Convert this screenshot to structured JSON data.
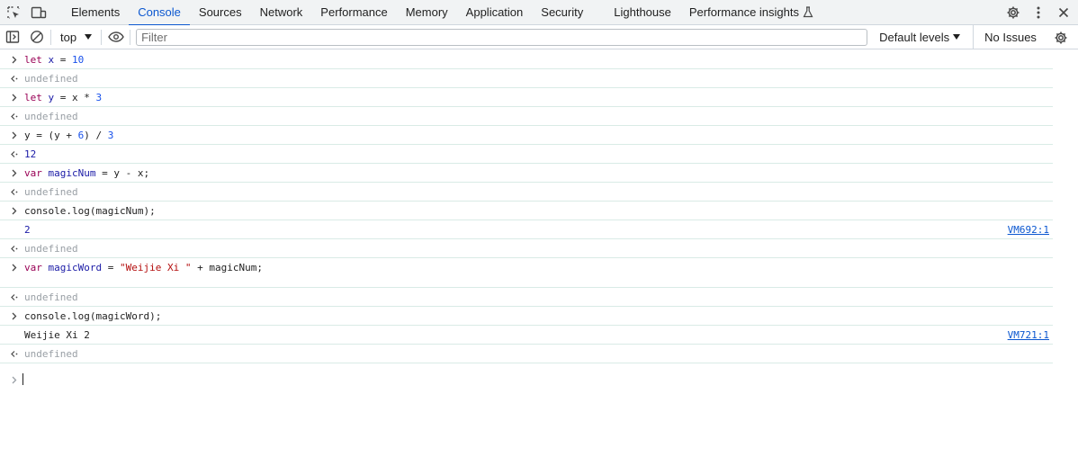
{
  "tabs": [
    "Elements",
    "Console",
    "Sources",
    "Network",
    "Performance",
    "Memory",
    "Application",
    "Security",
    "Lighthouse",
    "Performance insights"
  ],
  "active_tab": "Console",
  "toolbar": {
    "context": "top",
    "filter_placeholder": "Filter",
    "filter_value": "",
    "levels": "Default levels",
    "issues": "No Issues"
  },
  "console": {
    "lines": [
      {
        "kind": "input",
        "tokens": [
          [
            "kw",
            "let"
          ],
          [
            "plain",
            " "
          ],
          [
            "vname",
            "x"
          ],
          [
            "plain",
            " = "
          ],
          [
            "num",
            "10"
          ]
        ]
      },
      {
        "kind": "result",
        "text": "undefined",
        "muted": true
      },
      {
        "kind": "input",
        "tokens": [
          [
            "kw",
            "let"
          ],
          [
            "plain",
            " "
          ],
          [
            "vname",
            "y"
          ],
          [
            "plain",
            " = x * "
          ],
          [
            "num",
            "3"
          ]
        ]
      },
      {
        "kind": "result",
        "text": "undefined",
        "muted": true
      },
      {
        "kind": "input",
        "tokens": [
          [
            "plain",
            "y = (y + "
          ],
          [
            "num",
            "6"
          ],
          [
            "plain",
            ") / "
          ],
          [
            "num",
            "3"
          ]
        ]
      },
      {
        "kind": "result",
        "text": "12",
        "muted": false
      },
      {
        "kind": "input",
        "tokens": [
          [
            "kw",
            "var"
          ],
          [
            "plain",
            " "
          ],
          [
            "vname",
            "magicNum"
          ],
          [
            "plain",
            " = y - x;"
          ]
        ]
      },
      {
        "kind": "result",
        "text": "undefined",
        "muted": true
      },
      {
        "kind": "input",
        "tokens": [
          [
            "plain",
            "console.log(magicNum);"
          ]
        ]
      },
      {
        "kind": "log",
        "text": "2",
        "source": "VM692:1",
        "color": "#1a1aa6"
      },
      {
        "kind": "result",
        "text": "undefined",
        "muted": true
      },
      {
        "kind": "input-tall",
        "tokens": [
          [
            "kw",
            "var"
          ],
          [
            "plain",
            " "
          ],
          [
            "vname",
            "magicWord"
          ],
          [
            "plain",
            " = "
          ],
          [
            "str",
            "\"Weijie Xi \""
          ],
          [
            "plain",
            " + magicNum;"
          ]
        ]
      },
      {
        "kind": "result",
        "text": "undefined",
        "muted": true
      },
      {
        "kind": "input",
        "tokens": [
          [
            "plain",
            "console.log(magicWord);"
          ]
        ]
      },
      {
        "kind": "log",
        "text": "Weijie Xi 2",
        "source": "VM721:1",
        "color": "#1f1f1f"
      },
      {
        "kind": "result",
        "text": "undefined",
        "muted": true
      }
    ]
  },
  "colors": {
    "accent": "#0b57d0",
    "keyword": "#990055",
    "variable": "#1a1aa6",
    "number": "#1750eb",
    "string": "#b40e0e",
    "muted": "#9aa0a6"
  },
  "icons": {
    "inspect": "inspect-element-icon",
    "device": "device-toolbar-icon",
    "flask": "flask-icon",
    "settings": "gear-icon",
    "more": "more-vertical-icon",
    "close": "close-icon",
    "sidebar": "sidebar-toggle-icon",
    "clear": "clear-console-icon",
    "eye": "live-expression-icon"
  }
}
